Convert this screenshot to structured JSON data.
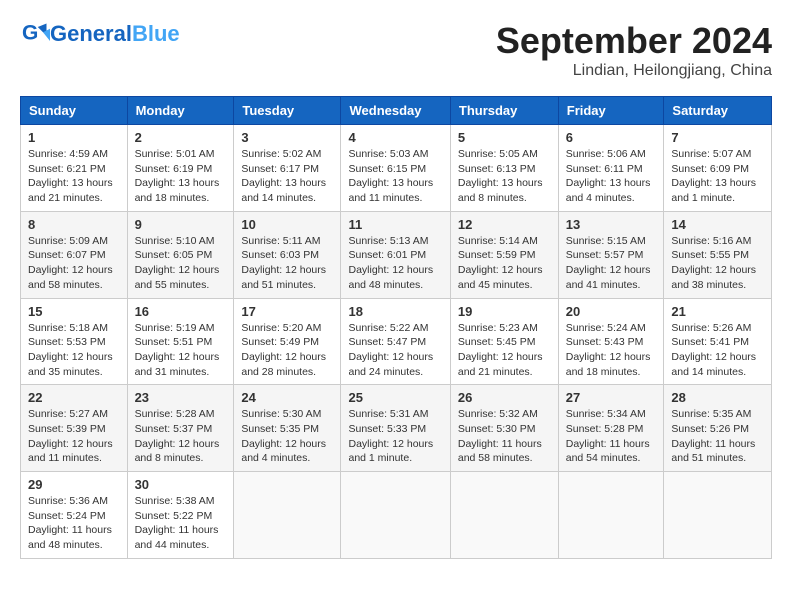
{
  "header": {
    "logo_general": "General",
    "logo_blue": "Blue",
    "month_title": "September 2024",
    "location": "Lindian, Heilongjiang, China"
  },
  "weekdays": [
    "Sunday",
    "Monday",
    "Tuesday",
    "Wednesday",
    "Thursday",
    "Friday",
    "Saturday"
  ],
  "weeks": [
    [
      {
        "day": "1",
        "info": "Sunrise: 4:59 AM\nSunset: 6:21 PM\nDaylight: 13 hours\nand 21 minutes."
      },
      {
        "day": "2",
        "info": "Sunrise: 5:01 AM\nSunset: 6:19 PM\nDaylight: 13 hours\nand 18 minutes."
      },
      {
        "day": "3",
        "info": "Sunrise: 5:02 AM\nSunset: 6:17 PM\nDaylight: 13 hours\nand 14 minutes."
      },
      {
        "day": "4",
        "info": "Sunrise: 5:03 AM\nSunset: 6:15 PM\nDaylight: 13 hours\nand 11 minutes."
      },
      {
        "day": "5",
        "info": "Sunrise: 5:05 AM\nSunset: 6:13 PM\nDaylight: 13 hours\nand 8 minutes."
      },
      {
        "day": "6",
        "info": "Sunrise: 5:06 AM\nSunset: 6:11 PM\nDaylight: 13 hours\nand 4 minutes."
      },
      {
        "day": "7",
        "info": "Sunrise: 5:07 AM\nSunset: 6:09 PM\nDaylight: 13 hours\nand 1 minute."
      }
    ],
    [
      {
        "day": "8",
        "info": "Sunrise: 5:09 AM\nSunset: 6:07 PM\nDaylight: 12 hours\nand 58 minutes."
      },
      {
        "day": "9",
        "info": "Sunrise: 5:10 AM\nSunset: 6:05 PM\nDaylight: 12 hours\nand 55 minutes."
      },
      {
        "day": "10",
        "info": "Sunrise: 5:11 AM\nSunset: 6:03 PM\nDaylight: 12 hours\nand 51 minutes."
      },
      {
        "day": "11",
        "info": "Sunrise: 5:13 AM\nSunset: 6:01 PM\nDaylight: 12 hours\nand 48 minutes."
      },
      {
        "day": "12",
        "info": "Sunrise: 5:14 AM\nSunset: 5:59 PM\nDaylight: 12 hours\nand 45 minutes."
      },
      {
        "day": "13",
        "info": "Sunrise: 5:15 AM\nSunset: 5:57 PM\nDaylight: 12 hours\nand 41 minutes."
      },
      {
        "day": "14",
        "info": "Sunrise: 5:16 AM\nSunset: 5:55 PM\nDaylight: 12 hours\nand 38 minutes."
      }
    ],
    [
      {
        "day": "15",
        "info": "Sunrise: 5:18 AM\nSunset: 5:53 PM\nDaylight: 12 hours\nand 35 minutes."
      },
      {
        "day": "16",
        "info": "Sunrise: 5:19 AM\nSunset: 5:51 PM\nDaylight: 12 hours\nand 31 minutes."
      },
      {
        "day": "17",
        "info": "Sunrise: 5:20 AM\nSunset: 5:49 PM\nDaylight: 12 hours\nand 28 minutes."
      },
      {
        "day": "18",
        "info": "Sunrise: 5:22 AM\nSunset: 5:47 PM\nDaylight: 12 hours\nand 24 minutes."
      },
      {
        "day": "19",
        "info": "Sunrise: 5:23 AM\nSunset: 5:45 PM\nDaylight: 12 hours\nand 21 minutes."
      },
      {
        "day": "20",
        "info": "Sunrise: 5:24 AM\nSunset: 5:43 PM\nDaylight: 12 hours\nand 18 minutes."
      },
      {
        "day": "21",
        "info": "Sunrise: 5:26 AM\nSunset: 5:41 PM\nDaylight: 12 hours\nand 14 minutes."
      }
    ],
    [
      {
        "day": "22",
        "info": "Sunrise: 5:27 AM\nSunset: 5:39 PM\nDaylight: 12 hours\nand 11 minutes."
      },
      {
        "day": "23",
        "info": "Sunrise: 5:28 AM\nSunset: 5:37 PM\nDaylight: 12 hours\nand 8 minutes."
      },
      {
        "day": "24",
        "info": "Sunrise: 5:30 AM\nSunset: 5:35 PM\nDaylight: 12 hours\nand 4 minutes."
      },
      {
        "day": "25",
        "info": "Sunrise: 5:31 AM\nSunset: 5:33 PM\nDaylight: 12 hours\nand 1 minute."
      },
      {
        "day": "26",
        "info": "Sunrise: 5:32 AM\nSunset: 5:30 PM\nDaylight: 11 hours\nand 58 minutes."
      },
      {
        "day": "27",
        "info": "Sunrise: 5:34 AM\nSunset: 5:28 PM\nDaylight: 11 hours\nand 54 minutes."
      },
      {
        "day": "28",
        "info": "Sunrise: 5:35 AM\nSunset: 5:26 PM\nDaylight: 11 hours\nand 51 minutes."
      }
    ],
    [
      {
        "day": "29",
        "info": "Sunrise: 5:36 AM\nSunset: 5:24 PM\nDaylight: 11 hours\nand 48 minutes."
      },
      {
        "day": "30",
        "info": "Sunrise: 5:38 AM\nSunset: 5:22 PM\nDaylight: 11 hours\nand 44 minutes."
      },
      {
        "day": "",
        "info": ""
      },
      {
        "day": "",
        "info": ""
      },
      {
        "day": "",
        "info": ""
      },
      {
        "day": "",
        "info": ""
      },
      {
        "day": "",
        "info": ""
      }
    ]
  ]
}
